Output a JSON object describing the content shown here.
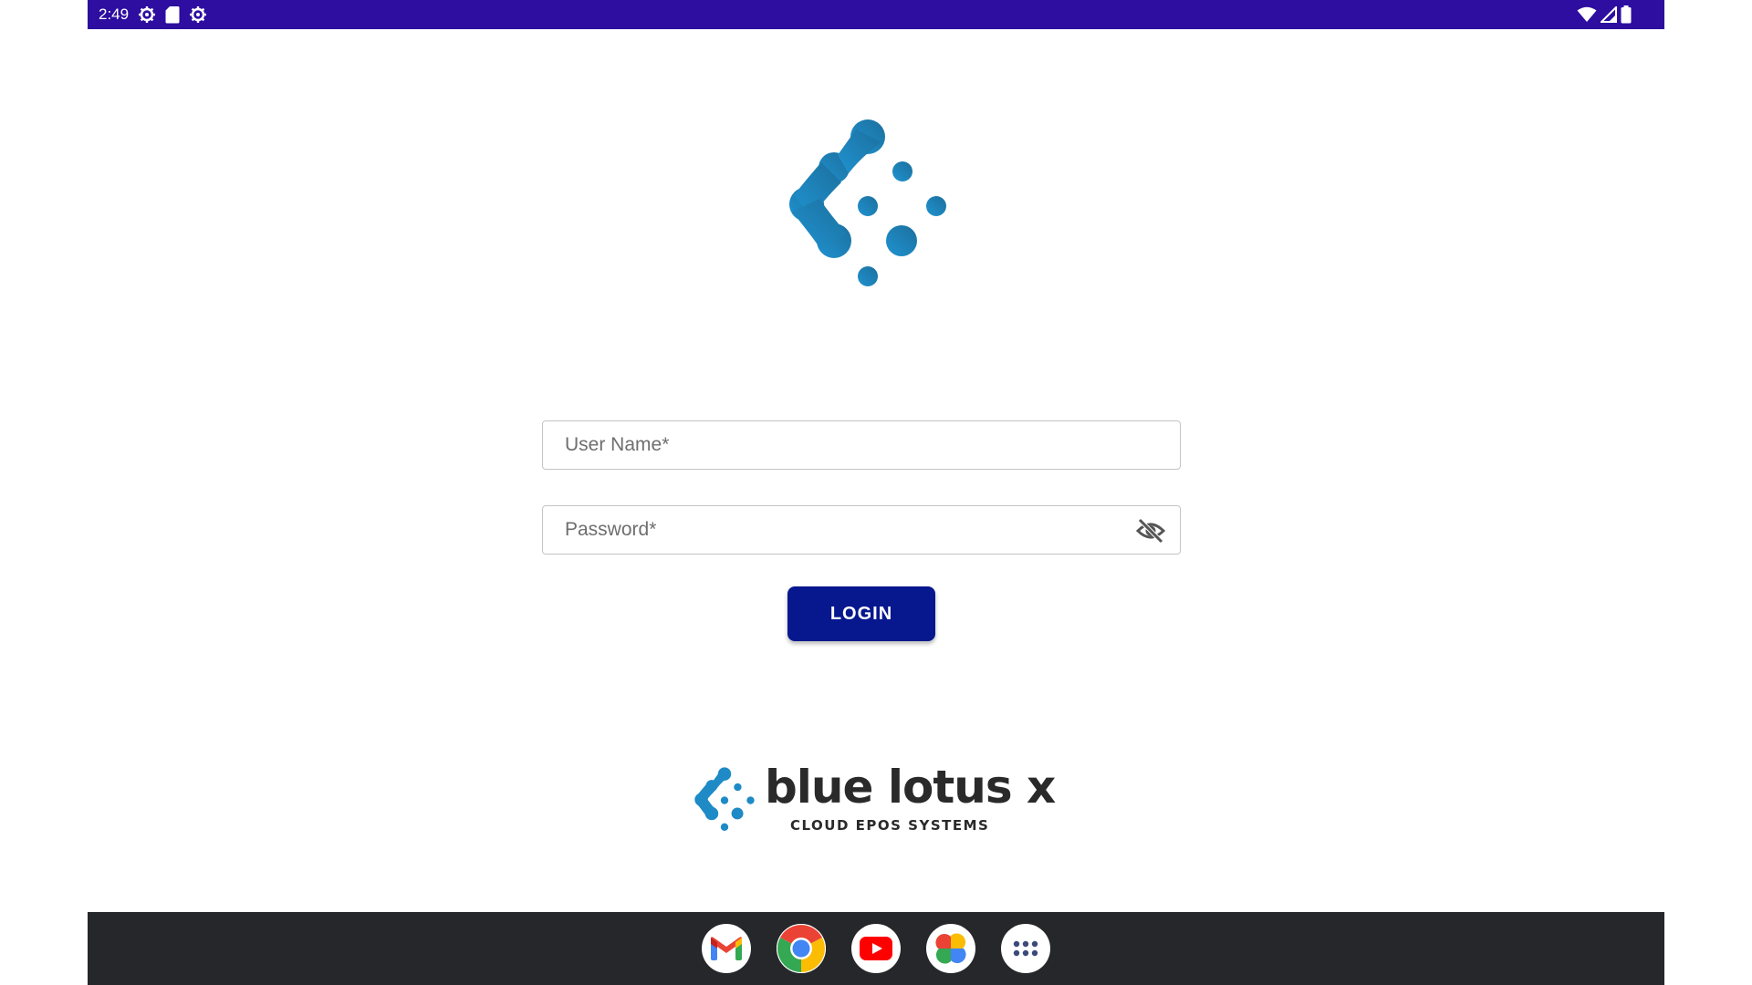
{
  "status_bar": {
    "time": "2:49",
    "left_icons": [
      "settings-gear-icon",
      "sd-card-icon",
      "settings-gear-icon"
    ],
    "right_icons": [
      "wifi-icon",
      "cellular-signal-icon",
      "battery-icon"
    ],
    "background": "#2d0ea0"
  },
  "login_form": {
    "username_placeholder": "User Name*",
    "password_placeholder": "Password*",
    "password_toggle_icon": "visibility-off-icon",
    "login_label": "LOGIN",
    "login_color": "#07178e"
  },
  "brand": {
    "name": "blue lotus x",
    "tagline": "CLOUD EPOS SYSTEMS",
    "logo_color": "#1e8ac6"
  },
  "taskbar": {
    "apps": [
      {
        "name": "gmail-icon"
      },
      {
        "name": "chrome-icon"
      },
      {
        "name": "youtube-icon"
      },
      {
        "name": "photos-icon"
      },
      {
        "name": "app-drawer-icon"
      }
    ],
    "background": "#26272b"
  }
}
